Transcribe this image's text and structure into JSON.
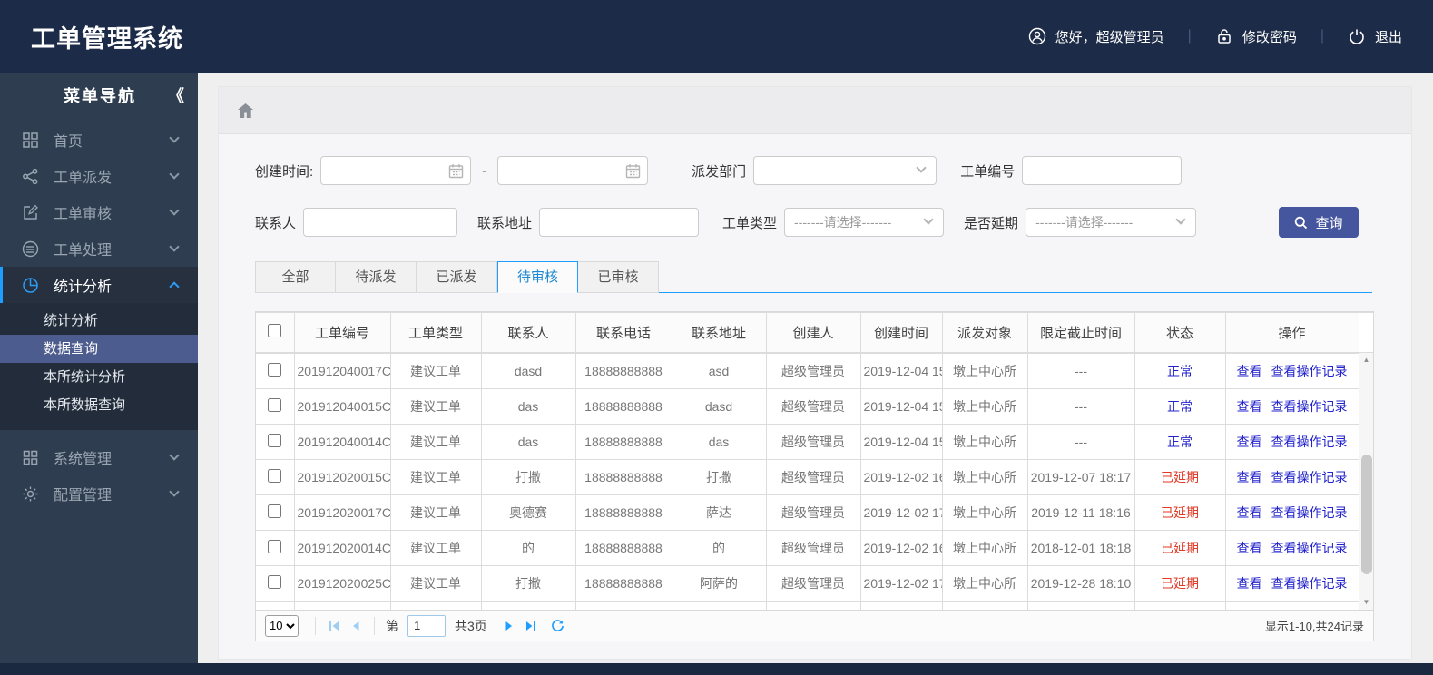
{
  "header": {
    "title": "工单管理系统",
    "greeting": "您好，超级管理员",
    "separator": "|",
    "change_password": "修改密码",
    "logout": "退出"
  },
  "sidebar": {
    "title": "菜单导航",
    "collapse_glyph": "《",
    "items": [
      {
        "label": "首页",
        "icon": "grid-icon"
      },
      {
        "label": "工单派发",
        "icon": "share-icon"
      },
      {
        "label": "工单审核",
        "icon": "edit-icon"
      },
      {
        "label": "工单处理",
        "icon": "database-icon"
      },
      {
        "label": "统计分析",
        "icon": "pie-chart-icon"
      },
      {
        "label": "系统管理",
        "icon": "apps-icon"
      },
      {
        "label": "配置管理",
        "icon": "gear-icon"
      }
    ],
    "sub_items": [
      {
        "label": "统计分析"
      },
      {
        "label": "数据查询",
        "selected": true
      },
      {
        "label": "本所统计分析"
      },
      {
        "label": "本所数据查询"
      }
    ]
  },
  "filters": {
    "create_time_label": "创建时间:",
    "range_separator": "-",
    "dispatch_dept_label": "派发部门",
    "order_no_label": "工单编号",
    "contact_label": "联系人",
    "address_label": "联系地址",
    "order_type_label": "工单类型",
    "order_type_value": "-------请选择-------",
    "delay_label": "是否延期",
    "delay_value": "-------请选择-------",
    "search_button": "查询"
  },
  "tabs": [
    {
      "label": "全部",
      "active": false
    },
    {
      "label": "待派发",
      "active": false
    },
    {
      "label": "已派发",
      "active": false
    },
    {
      "label": "待审核",
      "active": true
    },
    {
      "label": "已审核",
      "active": false
    }
  ],
  "table": {
    "columns": [
      "工单编号",
      "工单类型",
      "联系人",
      "联系电话",
      "联系地址",
      "创建人",
      "创建时间",
      "派发对象",
      "限定截止时间",
      "状态",
      "操作"
    ],
    "action_labels": [
      "查看",
      "查看操作记录"
    ],
    "rows": [
      {
        "order_no": "201912040017C",
        "type": "建议工单",
        "contact": "dasd",
        "phone": "18888888888",
        "address": "asd",
        "creator": "超级管理员",
        "created": "2019-12-04 15",
        "target": "墩上中心所",
        "deadline": "---",
        "status": "正常",
        "status_class": "normal"
      },
      {
        "order_no": "201912040015C",
        "type": "建议工单",
        "contact": "das",
        "phone": "18888888888",
        "address": "dasd",
        "creator": "超级管理员",
        "created": "2019-12-04 15",
        "target": "墩上中心所",
        "deadline": "---",
        "status": "正常",
        "status_class": "normal"
      },
      {
        "order_no": "201912040014C",
        "type": "建议工单",
        "contact": "das",
        "phone": "18888888888",
        "address": "das",
        "creator": "超级管理员",
        "created": "2019-12-04 15",
        "target": "墩上中心所",
        "deadline": "---",
        "status": "正常",
        "status_class": "normal"
      },
      {
        "order_no": "201912020015C",
        "type": "建议工单",
        "contact": "打撒",
        "phone": "18888888888",
        "address": "打撒",
        "creator": "超级管理员",
        "created": "2019-12-02 16",
        "target": "墩上中心所",
        "deadline": "2019-12-07 18:17",
        "status": "已延期",
        "status_class": "overdue"
      },
      {
        "order_no": "201912020017C",
        "type": "建议工单",
        "contact": "奥德赛",
        "phone": "18888888888",
        "address": "萨达",
        "creator": "超级管理员",
        "created": "2019-12-02 17",
        "target": "墩上中心所",
        "deadline": "2019-12-11 18:16",
        "status": "已延期",
        "status_class": "overdue"
      },
      {
        "order_no": "201912020014C",
        "type": "建议工单",
        "contact": "的",
        "phone": "18888888888",
        "address": "的",
        "creator": "超级管理员",
        "created": "2019-12-02 16",
        "target": "墩上中心所",
        "deadline": "2018-12-01 18:18",
        "status": "已延期",
        "status_class": "overdue"
      },
      {
        "order_no": "201912020025C",
        "type": "建议工单",
        "contact": "打撒",
        "phone": "18888888888",
        "address": "阿萨的",
        "creator": "超级管理员",
        "created": "2019-12-02 17",
        "target": "墩上中心所",
        "deadline": "2019-12-28 18:10",
        "status": "已延期",
        "status_class": "overdue"
      }
    ]
  },
  "pagination": {
    "page_size": "10",
    "page_prefix": "第",
    "current_page": "1",
    "total_pages": "共3页",
    "summary": "显示1-10,共24记录"
  },
  "colors": {
    "header_navy": "#1c2b47",
    "sidebar_slate": "#2e3d50",
    "selected_submenu": "#4d5c8e",
    "accent_blue": "#1e9fff",
    "button_indigo": "#46569e",
    "link_blue": "#2323cc",
    "status_normal": "#2323cc",
    "status_overdue": "#e03a26"
  }
}
